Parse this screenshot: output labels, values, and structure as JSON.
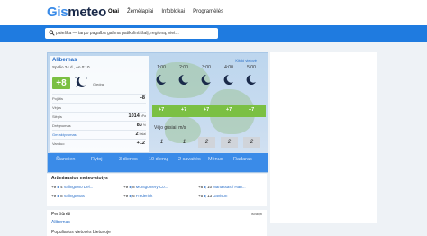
{
  "logo": {
    "part1": "Gis",
    "part2": "meteo"
  },
  "nav": [
    "Orai",
    "Žemėlapiai",
    "Infoblokai",
    "Programėlės"
  ],
  "search": {
    "placeholder": "paieška — tarpo pagalba galima patikslinti šalį, regioną, viet..."
  },
  "current": {
    "city": "Alibernas",
    "date_time": "Spalio 24 d., An 0:10",
    "temperature": "+8",
    "condition": "Giedra",
    "rows": [
      {
        "label": "Pojūtis",
        "value": "+8",
        "unit": ""
      },
      {
        "label": "Vėjas",
        "value": "",
        "unit": ""
      },
      {
        "label": "Slėgis",
        "value": "1014",
        "unit": "hPa"
      },
      {
        "label": "Drėgnumas",
        "value": "83",
        "unit": "%"
      },
      {
        "label": "Gm aktyvumas",
        "value": "2",
        "unit": "balai"
      },
      {
        "label": "Vanduo",
        "value": "+12",
        "unit": ""
      }
    ]
  },
  "hourly": {
    "link": "Kitoki vietovė",
    "hours": [
      "1:00",
      "2:00",
      "3:00",
      "4:00",
      "5:00"
    ],
    "temps": [
      "+7",
      "+7",
      "+7",
      "+7",
      "+7"
    ],
    "wind_label": "Vėjo gūsiai, m/s",
    "wind": [
      "1",
      "1",
      "2",
      "2",
      "2"
    ]
  },
  "tabs": [
    "Šiandien",
    "Rytoj",
    "3 dienos",
    "10 dienų",
    "2 savaitės",
    "Mėnuo",
    "Radaras"
  ],
  "nearest": {
    "title": "Artimiausios meteo-stotys",
    "stations": [
      {
        "temp": "+9",
        "dist": "4",
        "name": "Valingtono Del..."
      },
      {
        "temp": "+9",
        "dist": "8",
        "name": "Montgomery Co..."
      },
      {
        "temp": "+8",
        "dist": "10",
        "name": "Manassas / Harr..."
      },
      {
        "temp": "+9",
        "dist": "8",
        "name": "Valingtonas"
      },
      {
        "temp": "+9",
        "dist": "6",
        "name": "Frederick"
      },
      {
        "temp": "+5",
        "dist": "13",
        "name": "Davison"
      }
    ]
  },
  "viewed": {
    "title": "Peržiūrėti",
    "clear": "išvalyti",
    "city": "Alibernas",
    "popular": "Populiarios vietovės Lietuvoje"
  },
  "colors": {
    "accent": "#3a8be8",
    "temp_green": "#7bc043",
    "search_bar": "#1f7be0"
  }
}
